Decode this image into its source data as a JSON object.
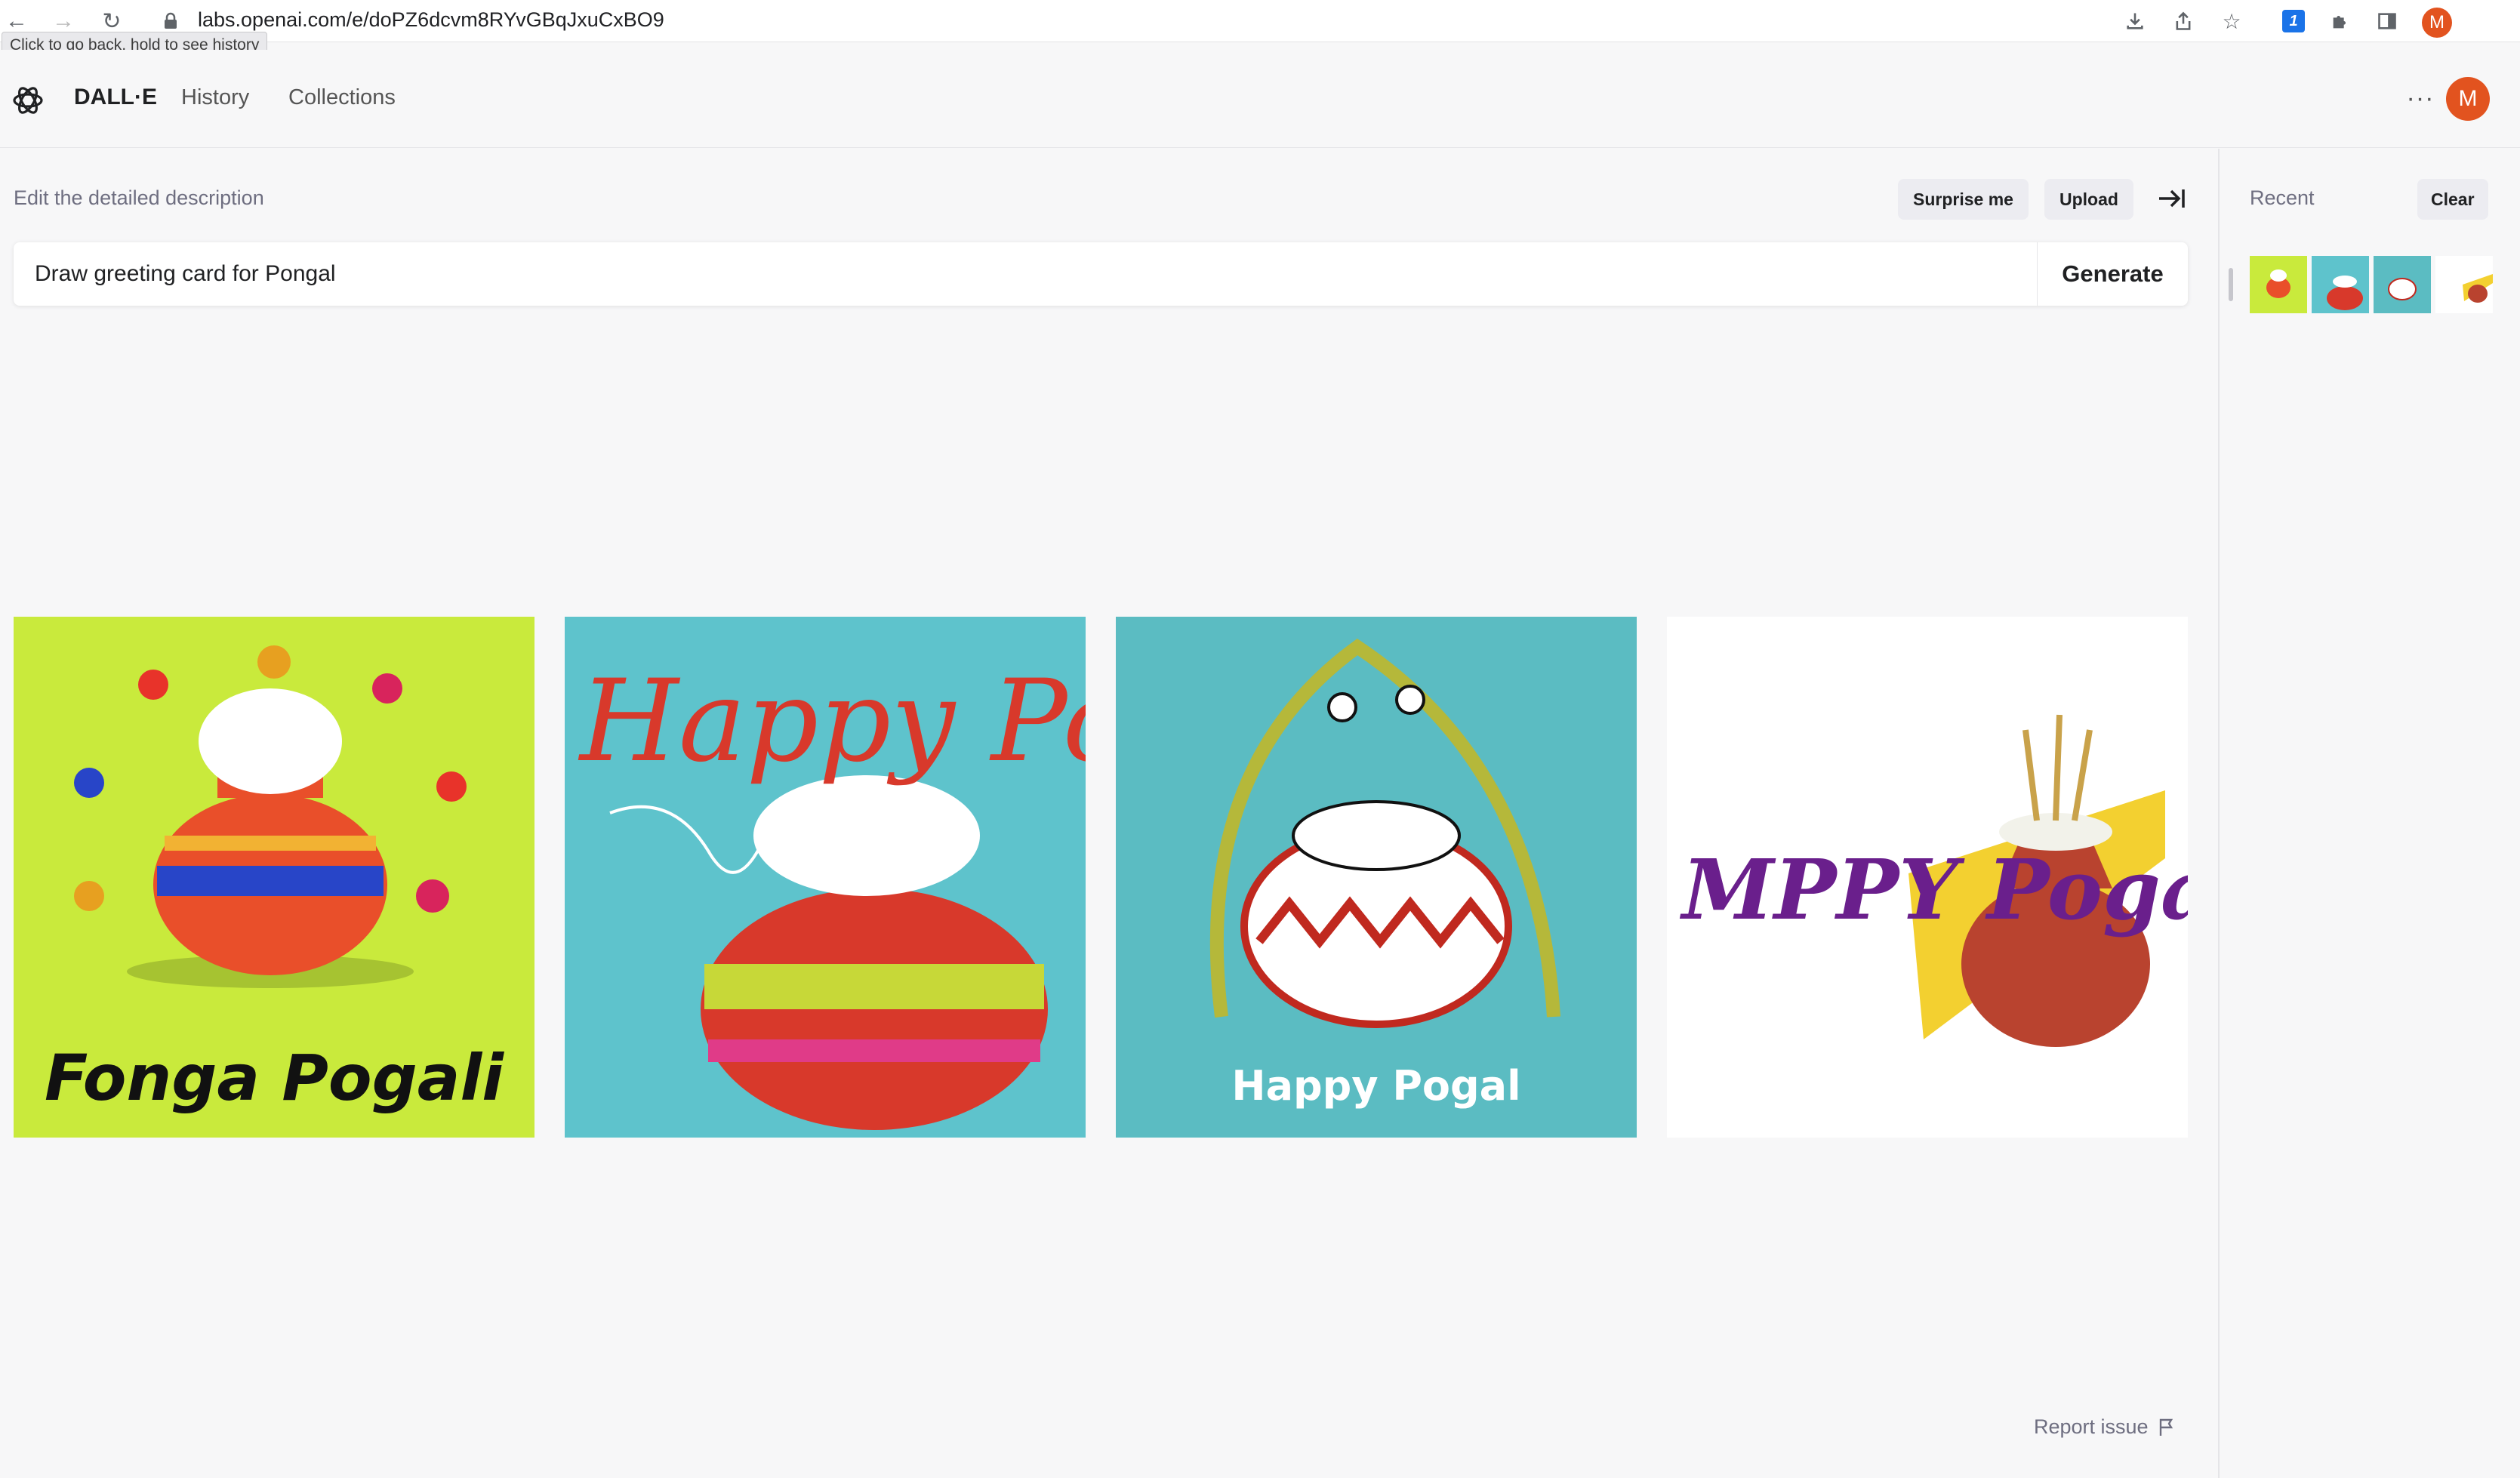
{
  "browser": {
    "url": "labs.openai.com/e/doPZ6dcvm8RYvGBqJxuCxBO9",
    "tooltip": "Click to go back, hold to see history",
    "profile_initial": "M",
    "extension_badge": "1"
  },
  "header": {
    "brand": "DALL·E",
    "nav": [
      "History",
      "Collections"
    ],
    "more": "···",
    "user_initial": "M"
  },
  "editor": {
    "label": "Edit the detailed description",
    "surprise_label": "Surprise me",
    "upload_label": "Upload",
    "prompt_value": "Draw greeting card for Pongal",
    "generate_label": "Generate"
  },
  "images": [
    {
      "caption": "Fonga Pogali",
      "bg": "#c9ea3c"
    },
    {
      "caption": "Happy Poggal",
      "bg": "#5ec3cc"
    },
    {
      "caption": "Happy Pogal",
      "bg": "#5bbcc2"
    },
    {
      "caption": "MPPY Pogal",
      "bg": "#ffffff"
    }
  ],
  "footer": {
    "report_label": "Report issue"
  },
  "sidebar": {
    "recent_label": "Recent",
    "clear_label": "Clear"
  },
  "colors": {
    "accent_avatar": "#e2531f",
    "pill_bg": "#ececf1"
  }
}
